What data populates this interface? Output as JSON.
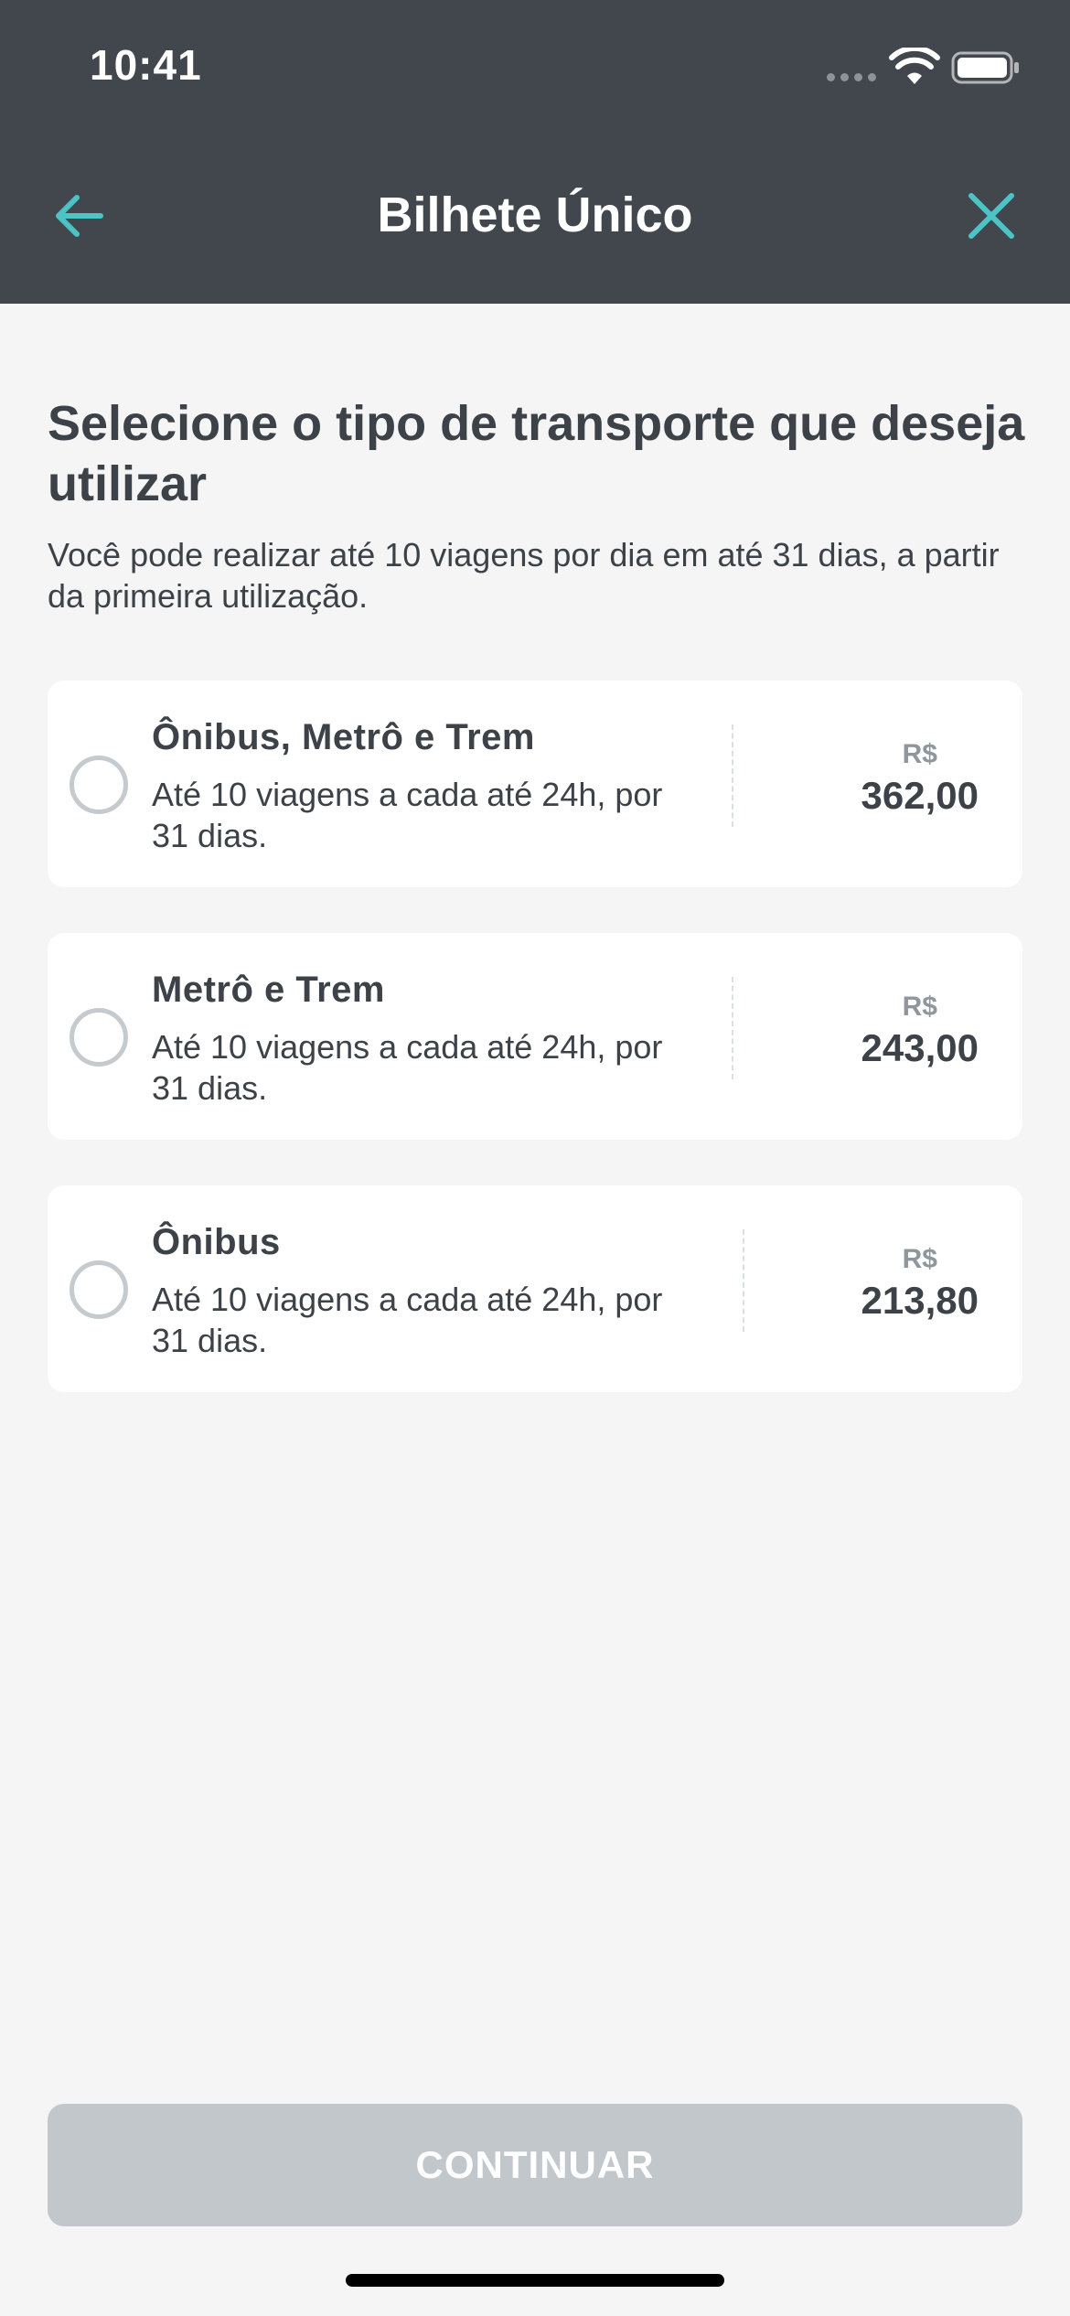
{
  "status_bar": {
    "time": "10:41"
  },
  "nav": {
    "title": "Bilhete Único"
  },
  "main": {
    "headline": "Selecione o tipo de transporte que deseja utilizar",
    "subtext": "Você pode realizar até 10 viagens por dia em até 31 dias, a partir da primeira utilização."
  },
  "options": [
    {
      "title": "Ônibus, Metrô e Trem",
      "desc": "Até 10 viagens a cada até 24h, por 31 dias.",
      "currency": "R$",
      "price": "362,00",
      "selected": false
    },
    {
      "title": "Metrô e Trem",
      "desc": "Até 10 viagens a cada até 24h, por 31 dias.",
      "currency": "R$",
      "price": "243,00",
      "selected": false
    },
    {
      "title": "Ônibus",
      "desc": "Até 10 viagens a cada até 24h, por 31 dias.",
      "currency": "R$",
      "price": "213,80",
      "selected": false
    }
  ],
  "continue_label": "CONTINUAR",
  "colors": {
    "header_bg": "#41474c",
    "accent": "#4cc3c4",
    "disabled_button": "#c1c7cb",
    "background": "#f5f5f5"
  },
  "icons": {
    "back": "arrow-left-icon",
    "close": "close-icon",
    "wifi": "wifi-icon",
    "battery": "battery-icon"
  }
}
